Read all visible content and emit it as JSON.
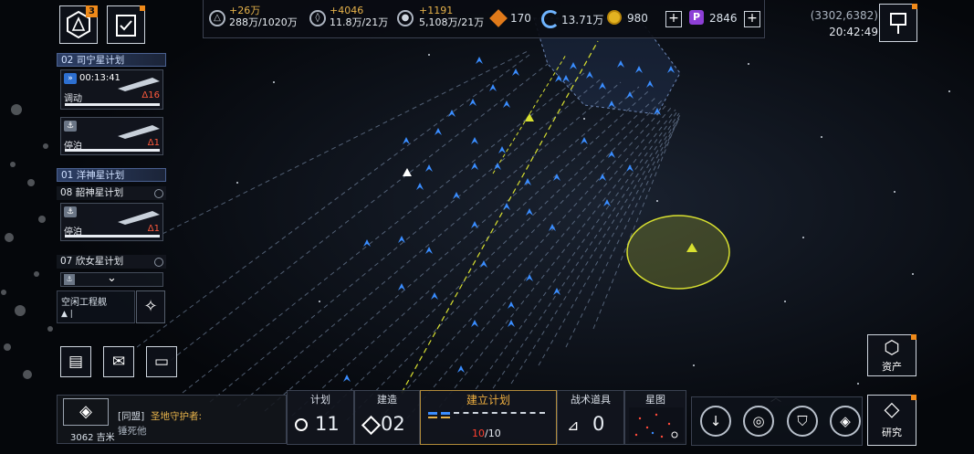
{
  "top_left": {
    "nav_badge": "3"
  },
  "resources": [
    {
      "icon": "triangle-metal-icon",
      "income": "+26万",
      "total": "288万/1020万"
    },
    {
      "icon": "crystal-icon",
      "income": "+4046",
      "total": "11.8万/21万"
    },
    {
      "icon": "deuterium-icon",
      "income": "+1191",
      "total": "5,108万/21万"
    }
  ],
  "currencies": [
    {
      "icon": "orange-hex-icon",
      "value": "170"
    },
    {
      "icon": "cycle-icon",
      "value": "13.71万"
    },
    {
      "icon": "gold-coin-icon",
      "value": "980"
    },
    {
      "icon": "purple-p-icon",
      "value": "2846"
    }
  ],
  "coords": "(3302,6382)",
  "clock": "20:42:49",
  "plans": [
    {
      "label": "02 司宁星计划",
      "active": true
    },
    {
      "label": "01 洋神星计划",
      "active": true
    },
    {
      "label": "08 韶神星计划",
      "active": false
    },
    {
      "label": "07 欣女星计划",
      "active": false
    }
  ],
  "fleet_cards": [
    {
      "status": "调动",
      "timer": "00:13:41",
      "count": "Δ16"
    },
    {
      "status": "停泊",
      "count": "Δ1"
    },
    {
      "status": "停泊",
      "count": "Δ1"
    }
  ],
  "idle_engineer": {
    "label": "空闲工程舰",
    "value": "▲ |"
  },
  "chat": {
    "distance": "3062 吉米",
    "channel": "[同盟]",
    "sender": "圣地守护者:",
    "message": "锤死他"
  },
  "tabs": {
    "plan": {
      "label": "计划",
      "value": "11"
    },
    "build": {
      "label": "建造",
      "value": "02"
    },
    "create": {
      "label": "建立计划",
      "current": "10",
      "max": "/10"
    },
    "tactics": {
      "label": "战术道具",
      "value": "0"
    },
    "starmap": {
      "label": "星图"
    }
  },
  "right": {
    "assets_label": "资产",
    "research_label": "研究"
  },
  "colors": {
    "accent_gold": "#e6b24a",
    "ship_blue": "#3a8dff",
    "target_yellow": "#d8e030",
    "danger_red": "#ff5a3c"
  }
}
